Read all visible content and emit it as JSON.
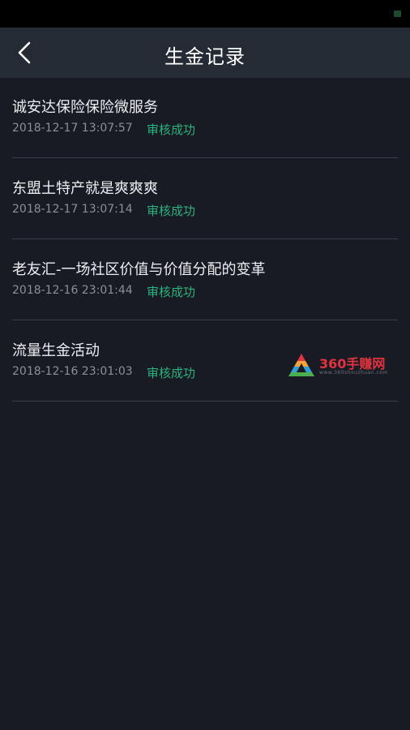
{
  "header": {
    "title": "生金记录",
    "back_icon": "chevron-left-icon"
  },
  "records": [
    {
      "title": "诚安达保险保险微服务",
      "date": "2018-12-17 13:07:57",
      "status": "审核成功"
    },
    {
      "title": "东盟土特产就是爽爽爽",
      "date": "2018-12-17 13:07:14",
      "status": "审核成功"
    },
    {
      "title": "老友汇-一场社区价值与价值分配的变革",
      "date": "2018-12-16 23:01:44",
      "status": "审核成功"
    },
    {
      "title": "流量生金活动",
      "date": "2018-12-16 23:01:03",
      "status": "审核成功"
    }
  ],
  "watermark": {
    "text": "360手赚网",
    "url": "www.360shouzhuan.com"
  },
  "colors": {
    "background": "#181b23",
    "nav_bar": "#252b35",
    "status_success": "#2db27d",
    "divider": "#3a404b",
    "watermark": "#e1333f"
  }
}
